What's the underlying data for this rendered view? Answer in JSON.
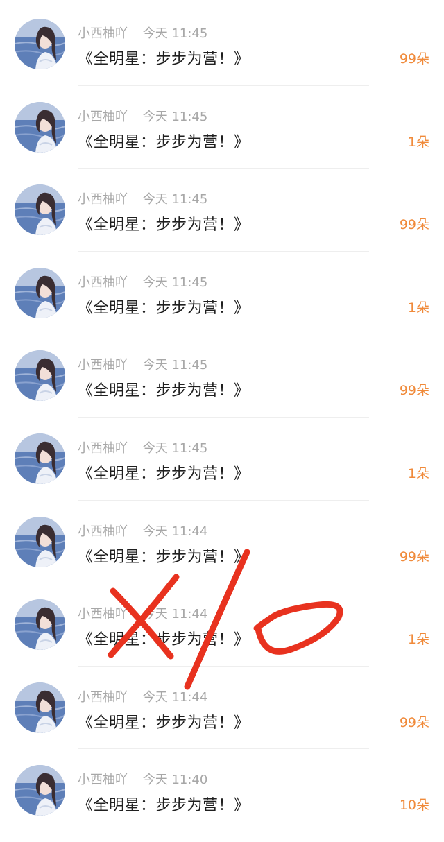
{
  "messages": [
    {
      "name": "小西柚吖",
      "time": "今天 11:45",
      "title": "《全明星：步步为营！》",
      "amount": "99朵"
    },
    {
      "name": "小西柚吖",
      "time": "今天 11:45",
      "title": "《全明星：步步为营！》",
      "amount": "1朵"
    },
    {
      "name": "小西柚吖",
      "time": "今天 11:45",
      "title": "《全明星：步步为营！》",
      "amount": "99朵"
    },
    {
      "name": "小西柚吖",
      "time": "今天 11:45",
      "title": "《全明星：步步为营！》",
      "amount": "1朵"
    },
    {
      "name": "小西柚吖",
      "time": "今天 11:45",
      "title": "《全明星：步步为营！》",
      "amount": "99朵"
    },
    {
      "name": "小西柚吖",
      "time": "今天 11:45",
      "title": "《全明星：步步为营！》",
      "amount": "1朵"
    },
    {
      "name": "小西柚吖",
      "time": "今天 11:44",
      "title": "《全明星：步步为营！》",
      "amount": "99朵"
    },
    {
      "name": "小西柚吖",
      "time": "今天 11:44",
      "title": "《全明星：步步为营！》",
      "amount": "1朵"
    },
    {
      "name": "小西柚吖",
      "time": "今天 11:44",
      "title": "《全明星：步步为营！》",
      "amount": "99朵"
    },
    {
      "name": "小西柚吖",
      "time": "今天 11:40",
      "title": "《全明星：步步为营！》",
      "amount": "10朵"
    }
  ],
  "colors": {
    "amount": "#f08a3a",
    "meta": "#a7a7a7",
    "title": "#1f1f1f",
    "annotation": "#e8321f"
  },
  "icons": {
    "avatar": "user-avatar-photo",
    "annotation": "handwritten-x-slash-zero-mark"
  }
}
